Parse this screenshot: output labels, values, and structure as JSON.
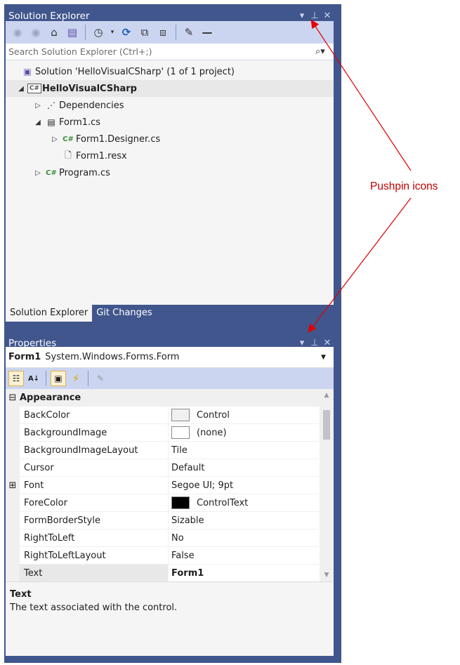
{
  "solution_explorer": {
    "title": "Solution Explorer",
    "search_placeholder": "Search Solution Explorer (Ctrl+;)",
    "tree": [
      {
        "label": "Solution 'HelloVisualCSharp' (1 of 1 project)",
        "icon": "solution-icon",
        "arrow": ""
      },
      {
        "label": "HelloVisualCSharp",
        "icon": "csharp-project-icon",
        "arrow": "◢"
      },
      {
        "label": "Dependencies",
        "icon": "dependencies-icon",
        "arrow": "▷"
      },
      {
        "label": "Form1.cs",
        "icon": "form-icon",
        "arrow": "◢"
      },
      {
        "label": "Form1.Designer.cs",
        "icon": "csharp-file-icon",
        "arrow": "▷"
      },
      {
        "label": "Form1.resx",
        "icon": "resource-file-icon",
        "arrow": ""
      },
      {
        "label": "Program.cs",
        "icon": "csharp-file-icon",
        "arrow": "▷"
      }
    ],
    "tabs": [
      "Solution Explorer",
      "Git Changes"
    ]
  },
  "properties": {
    "title": "Properties",
    "object_name": "Form1",
    "object_type": "System.Windows.Forms.Form",
    "category": "Appearance",
    "rows": [
      {
        "name": "BackColor",
        "value": "Control"
      },
      {
        "name": "BackgroundImage",
        "value": "(none)"
      },
      {
        "name": "BackgroundImageLayout",
        "value": "Tile"
      },
      {
        "name": "Cursor",
        "value": "Default"
      },
      {
        "name": "Font",
        "value": "Segoe UI; 9pt"
      },
      {
        "name": "ForeColor",
        "value": "ControlText"
      },
      {
        "name": "FormBorderStyle",
        "value": "Sizable"
      },
      {
        "name": "RightToLeft",
        "value": "No"
      },
      {
        "name": "RightToLeftLayout",
        "value": "False"
      },
      {
        "name": "Text",
        "value": "Form1"
      }
    ],
    "description_title": "Text",
    "description_text": "The text associated with the control."
  },
  "annotation": {
    "label": "Pushpin icons",
    "color": "#c00000"
  },
  "colors": {
    "header_bg": "#40568d",
    "toolbar_bg": "#ccd5f0",
    "swatch_control": "#f0f0f0",
    "swatch_controltext": "#000000"
  }
}
